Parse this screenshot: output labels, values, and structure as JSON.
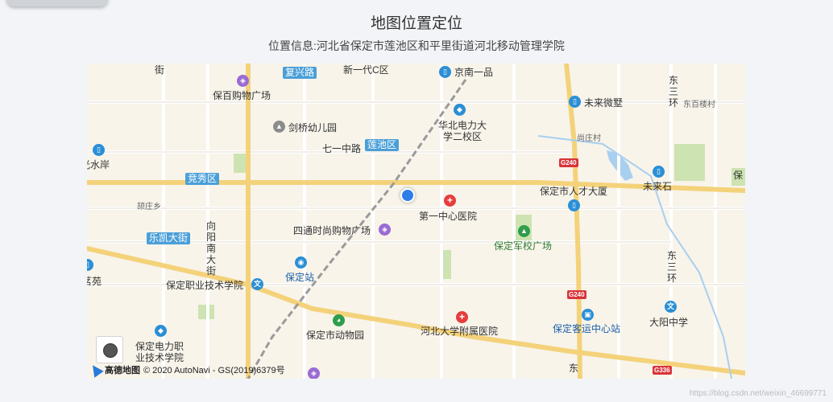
{
  "header": {
    "title": "地图位置定位",
    "location_info": "位置信息:河北省保定市莲池区和平里街道河北移动管理学院"
  },
  "map": {
    "road_labels": [
      "复兴路",
      "莲池区",
      "竞秀区",
      "乐凯大街"
    ],
    "places": [
      {
        "key": "jieLabel",
        "text": "街"
      },
      {
        "key": "xinyidai",
        "text": "新一代C区"
      },
      {
        "key": "jingnan",
        "text": "京南一品"
      },
      {
        "key": "dongsanhuan1",
        "text": "东三环"
      },
      {
        "key": "baobai",
        "text": "保百购物广场"
      },
      {
        "key": "weilai",
        "text": "未来微墅"
      },
      {
        "key": "dongbailou",
        "text": "东百楼村"
      },
      {
        "key": "jianqiao",
        "text": "剑桥幼儿园"
      },
      {
        "key": "huabei",
        "text": "华北电力大学二校区"
      },
      {
        "key": "qiyizhong",
        "text": "七一中路"
      },
      {
        "key": "shangzhuang",
        "text": "尚庄村"
      },
      {
        "key": "guangshui",
        "text": "光水岸"
      },
      {
        "key": "rencai",
        "text": "保定市人才大厦"
      },
      {
        "key": "weilaishi",
        "text": "未来石"
      },
      {
        "key": "bao",
        "text": "保"
      },
      {
        "key": "ying",
        "text": "颉庄乡"
      },
      {
        "key": "diyi",
        "text": "第一中心医院"
      },
      {
        "key": "xiangyang",
        "text": "向阳南大街"
      },
      {
        "key": "sitong",
        "text": "四通时尚购物广场"
      },
      {
        "key": "junxiao",
        "text": "保定军校广场"
      },
      {
        "key": "dongsanhuan2",
        "text": "东三环"
      },
      {
        "key": "mingyuan",
        "text": "茗苑"
      },
      {
        "key": "zhiye",
        "text": "保定职业技术学院"
      },
      {
        "key": "baodingzhan",
        "text": "保定站"
      },
      {
        "key": "keyun",
        "text": "保定客运中心站"
      },
      {
        "key": "dongwuyuan",
        "text": "保定市动物园"
      },
      {
        "key": "fushu",
        "text": "河北大学附属医院"
      },
      {
        "key": "dayang",
        "text": "大阳中学"
      },
      {
        "key": "dianli",
        "text": "保定电力职业技术学院"
      },
      {
        "key": "dong",
        "text": "东"
      }
    ],
    "highways": [
      "G240",
      "G240",
      "G336"
    ],
    "copyright": "© 2020 AutoNavi - GS(2019)6379号",
    "logo_text": "高德地图"
  },
  "watermark": "https://blog.csdn.net/weixin_46699771"
}
